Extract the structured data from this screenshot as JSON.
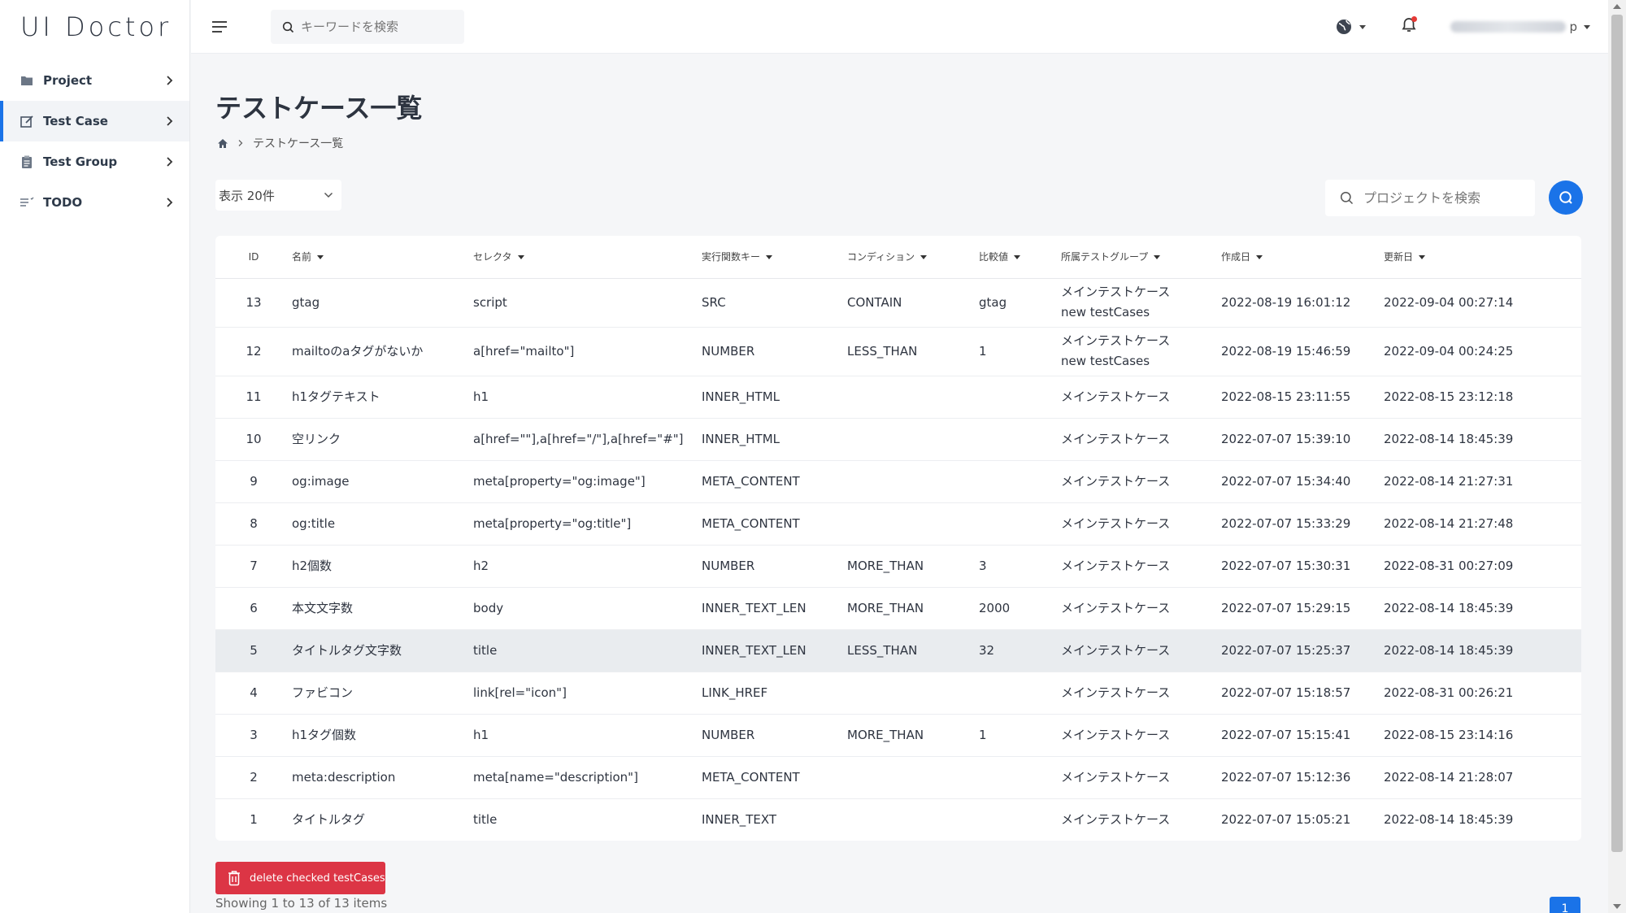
{
  "app": {
    "logo": "UI Doctor"
  },
  "sidebar": {
    "items": [
      {
        "label": "Project",
        "icon": "folder-icon"
      },
      {
        "label": "Test Case",
        "icon": "edit-icon",
        "active": true
      },
      {
        "label": "Test Group",
        "icon": "clipboard-icon"
      },
      {
        "label": "TODO",
        "icon": "list-icon"
      }
    ]
  },
  "header": {
    "search_placeholder": "キーワードを検索",
    "user_suffix": "p"
  },
  "main": {
    "title": "テストケース一覧",
    "breadcrumb_current": "テストケース一覧",
    "page_size": "表示 20件",
    "project_search_placeholder": "プロジェクトを検索"
  },
  "table": {
    "headers": {
      "id": "ID",
      "name": "名前",
      "selector": "セレクタ",
      "func_key": "実行関数キー",
      "condition": "コンディション",
      "compare": "比較値",
      "group": "所属テストグループ",
      "created": "作成日",
      "updated": "更新日"
    },
    "rows": [
      {
        "id": "13",
        "name": "gtag",
        "selector": "script",
        "func": "SRC",
        "cond": "CONTAIN",
        "cmp": "gtag",
        "group1": "メインテストケース",
        "group2": "new testCases",
        "created": "2022-08-19 16:01:12",
        "updated": "2022-09-04 00:27:14"
      },
      {
        "id": "12",
        "name": "mailtoのaタグがないか",
        "selector": "a[href=\"mailto\"]",
        "func": "NUMBER",
        "cond": "LESS_THAN",
        "cmp": "1",
        "group1": "メインテストケース",
        "group2": "new testCases",
        "created": "2022-08-19 15:46:59",
        "updated": "2022-09-04 00:24:25"
      },
      {
        "id": "11",
        "name": "h1タグテキスト",
        "selector": "h1",
        "func": "INNER_HTML",
        "cond": "",
        "cmp": "",
        "group1": "メインテストケース",
        "group2": "",
        "created": "2022-08-15 23:11:55",
        "updated": "2022-08-15 23:12:18"
      },
      {
        "id": "10",
        "name": "空リンク",
        "selector": "a[href=\"\"],a[href=\"/\"],a[href=\"#\"]",
        "func": "INNER_HTML",
        "cond": "",
        "cmp": "",
        "group1": "メインテストケース",
        "group2": "",
        "created": "2022-07-07 15:39:10",
        "updated": "2022-08-14 18:45:39"
      },
      {
        "id": "9",
        "name": "og:image",
        "selector": "meta[property=\"og:image\"]",
        "func": "META_CONTENT",
        "cond": "",
        "cmp": "",
        "group1": "メインテストケース",
        "group2": "",
        "created": "2022-07-07 15:34:40",
        "updated": "2022-08-14 21:27:31"
      },
      {
        "id": "8",
        "name": "og:title",
        "selector": "meta[property=\"og:title\"]",
        "func": "META_CONTENT",
        "cond": "",
        "cmp": "",
        "group1": "メインテストケース",
        "group2": "",
        "created": "2022-07-07 15:33:29",
        "updated": "2022-08-14 21:27:48"
      },
      {
        "id": "7",
        "name": "h2個数",
        "selector": "h2",
        "func": "NUMBER",
        "cond": "MORE_THAN",
        "cmp": "3",
        "group1": "メインテストケース",
        "group2": "",
        "created": "2022-07-07 15:30:31",
        "updated": "2022-08-31 00:27:09"
      },
      {
        "id": "6",
        "name": "本文文字数",
        "selector": "body",
        "func": "INNER_TEXT_LEN",
        "cond": "MORE_THAN",
        "cmp": "2000",
        "group1": "メインテストケース",
        "group2": "",
        "created": "2022-07-07 15:29:15",
        "updated": "2022-08-14 18:45:39"
      },
      {
        "id": "5",
        "name": "タイトルタグ文字数",
        "selector": "title",
        "func": "INNER_TEXT_LEN",
        "cond": "LESS_THAN",
        "cmp": "32",
        "group1": "メインテストケース",
        "group2": "",
        "created": "2022-07-07 15:25:37",
        "updated": "2022-08-14 18:45:39"
      },
      {
        "id": "4",
        "name": "ファビコン",
        "selector": "link[rel=\"icon\"]",
        "func": "LINK_HREF",
        "cond": "",
        "cmp": "",
        "group1": "メインテストケース",
        "group2": "",
        "created": "2022-07-07 15:18:57",
        "updated": "2022-08-31 00:26:21"
      },
      {
        "id": "3",
        "name": "h1タグ個数",
        "selector": "h1",
        "func": "NUMBER",
        "cond": "MORE_THAN",
        "cmp": "1",
        "group1": "メインテストケース",
        "group2": "",
        "created": "2022-07-07 15:15:41",
        "updated": "2022-08-15 23:14:16"
      },
      {
        "id": "2",
        "name": "meta:description",
        "selector": "meta[name=\"description\"]",
        "func": "META_CONTENT",
        "cond": "",
        "cmp": "",
        "group1": "メインテストケース",
        "group2": "",
        "created": "2022-07-07 15:12:36",
        "updated": "2022-08-14 21:28:07"
      },
      {
        "id": "1",
        "name": "タイトルタグ",
        "selector": "title",
        "func": "INNER_TEXT",
        "cond": "",
        "cmp": "",
        "group1": "メインテストケース",
        "group2": "",
        "created": "2022-07-07 15:05:21",
        "updated": "2022-08-14 18:45:39"
      }
    ]
  },
  "footer": {
    "delete_label": "delete checked testCases",
    "showing": "Showing 1 to 13 of 13 items",
    "current_page": "1"
  },
  "colors": {
    "accent": "#1a73e8",
    "danger": "#dc3545",
    "highlight_row": "#e9ecef"
  }
}
